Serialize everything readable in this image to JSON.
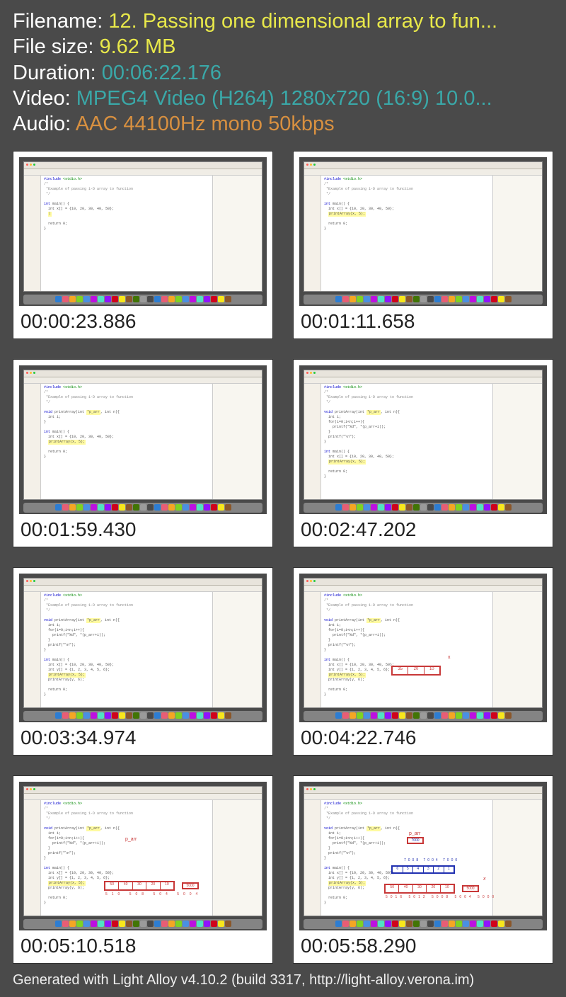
{
  "info": {
    "filename_label": "Filename: ",
    "filename_value": "12. Passing one dimensional array to fun...",
    "filesize_label": "File size: ",
    "filesize_value": "9.62 MB",
    "duration_label": "Duration: ",
    "duration_value": "00:06:22.176",
    "video_label": "Video: ",
    "video_value": "MPEG4 Video (H264) 1280x720 (16:9) 10.0...",
    "audio_label": "Audio: ",
    "audio_value": "AAC 44100Hz mono 50kbps"
  },
  "thumbnails": [
    {
      "timestamp": "00:00:23.886",
      "anno": 0
    },
    {
      "timestamp": "00:01:11.658",
      "anno": 0
    },
    {
      "timestamp": "00:01:59.430",
      "anno": 0
    },
    {
      "timestamp": "00:02:47.202",
      "anno": 0
    },
    {
      "timestamp": "00:03:34.974",
      "anno": 0
    },
    {
      "timestamp": "00:04:22.746",
      "anno": 1
    },
    {
      "timestamp": "00:05:10.518",
      "anno": 2
    },
    {
      "timestamp": "00:05:58.290",
      "anno": 3
    }
  ],
  "footer": "Generated with Light Alloy v4.10.2 (build 3317, http://light-alloy.verona.im)"
}
